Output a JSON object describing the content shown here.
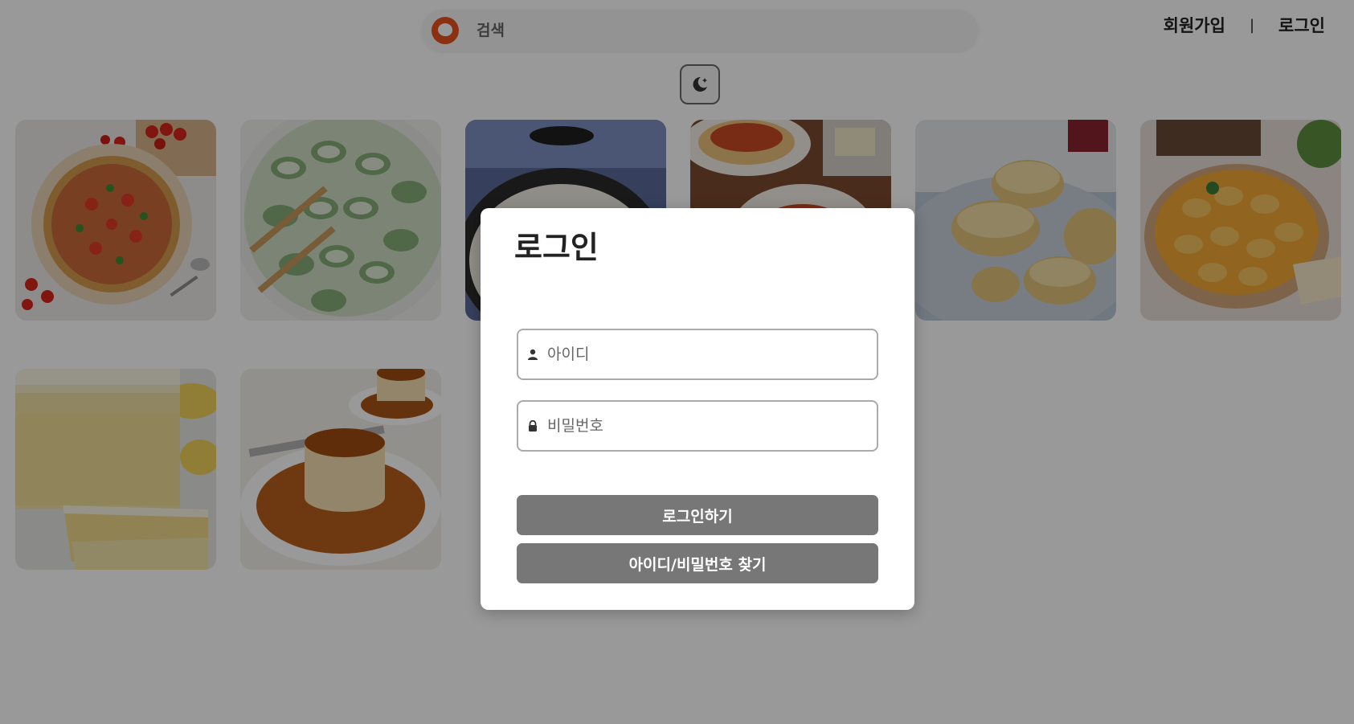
{
  "header": {
    "search_placeholder": "검색",
    "signup_label": "회원가입",
    "separator": "|",
    "login_label": "로그인"
  },
  "theme_toggle": {
    "icon": "moon-star-icon"
  },
  "grid": {
    "items": [
      {
        "name": "pizza-image"
      },
      {
        "name": "cucumber-salad-image"
      },
      {
        "name": "cream-stew-image"
      },
      {
        "name": "spaghetti-image"
      },
      {
        "name": "biscuits-image"
      },
      {
        "name": "orange-tart-image"
      },
      {
        "name": "lemon-pound-cake-image"
      },
      {
        "name": "caramel-pudding-image"
      }
    ]
  },
  "modal": {
    "title": "로그인",
    "id_placeholder": "아이디",
    "password_placeholder": "비밀번호",
    "login_button": "로그인하기",
    "find_button": "아이디/비밀번호 찾기"
  },
  "colors": {
    "brand": "#e8501b",
    "button": "#777777",
    "overlay": "rgba(0,0,0,0.40)"
  }
}
